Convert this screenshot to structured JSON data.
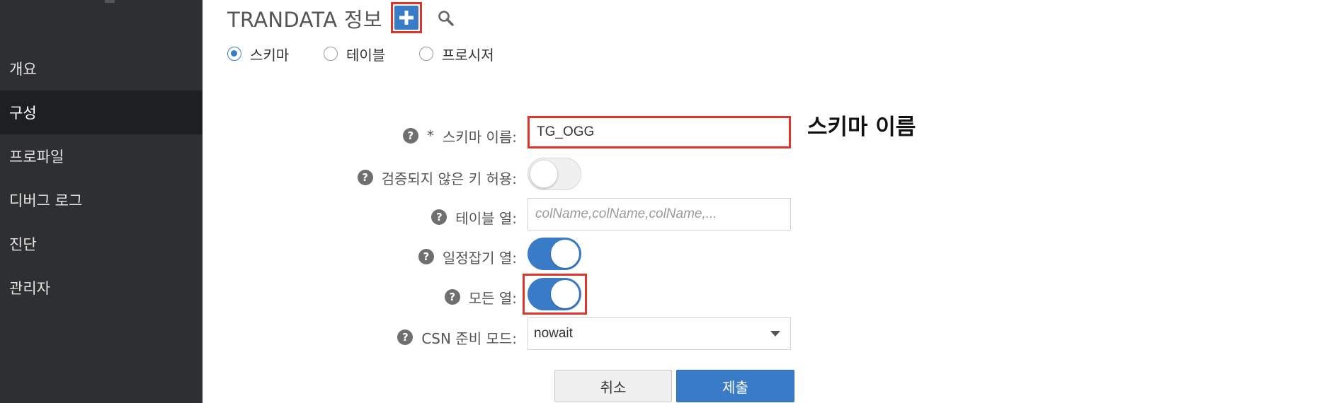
{
  "sidebar": {
    "items": [
      {
        "label": "개요"
      },
      {
        "label": "구성"
      },
      {
        "label": "프로파일"
      },
      {
        "label": "디버그 로그"
      },
      {
        "label": "진단"
      },
      {
        "label": "관리자"
      }
    ],
    "active_item": "구성"
  },
  "header": {
    "title": "TRANDATA 정보",
    "add_icon": "plus-icon",
    "search_icon": "search-icon"
  },
  "type_options": {
    "selected": "스키마",
    "options": [
      {
        "label": "스키마"
      },
      {
        "label": "테이블"
      },
      {
        "label": "프로시저"
      }
    ]
  },
  "form": {
    "schema_name": {
      "label": "스키마 이름:",
      "required_mark": "*",
      "value": "TG_OGG"
    },
    "allow_unvalidated_keys": {
      "label": "검증되지 않은 키 허용:",
      "on": false
    },
    "table_columns": {
      "label": "테이블 열:",
      "value": "",
      "placeholder": "colName,colName,colName,..."
    },
    "scheduling_columns": {
      "label": "일정잡기 열:",
      "on": true
    },
    "all_columns": {
      "label": "모든 열:",
      "on": true
    },
    "csn_prepare_mode": {
      "label": "CSN 준비 모드:",
      "value": "nowait"
    },
    "help_glyph": "?"
  },
  "buttons": {
    "cancel": "취소",
    "submit": "제출"
  },
  "annotation": {
    "text": "스키마 이름"
  },
  "colors": {
    "sidebar_bg": "#2e2f31",
    "sidebar_active_bg": "#1e1f20",
    "accent": "#3a7bc8",
    "highlight_border": "#e0342b"
  }
}
